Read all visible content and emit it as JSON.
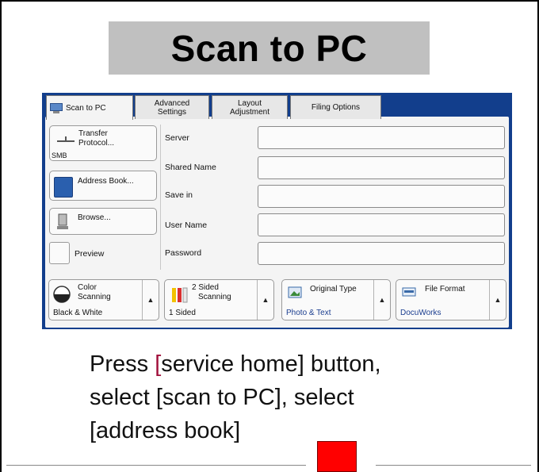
{
  "slide": {
    "title": "Scan to PC",
    "instruction_bracket": "[",
    "instruction_line1_rest": "service home] button,",
    "instruction_line2": "select [scan to PC], select",
    "instruction_line3": "[address book]"
  },
  "tabs": [
    {
      "label": "Scan to PC",
      "active": true,
      "icon": "pc-monitor-icon"
    },
    {
      "label_line1": "Advanced",
      "label_line2": "Settings"
    },
    {
      "label_line1": "Layout",
      "label_line2": "Adjustment"
    },
    {
      "label": "Filing Options"
    }
  ],
  "side_buttons": {
    "transfer_protocol": {
      "label_line1": "Transfer",
      "label_line2": "Protocol...",
      "value": "SMB",
      "icon": "network-icon"
    },
    "address_book": {
      "label": "Address Book...",
      "icon": "address-book-icon"
    },
    "browse": {
      "label": "Browse...",
      "icon": "computer-icon"
    },
    "preview": {
      "label": "Preview"
    }
  },
  "fields": [
    {
      "label": "Server",
      "value": ""
    },
    {
      "label": "Shared Name",
      "value": ""
    },
    {
      "label": "Save in",
      "value": ""
    },
    {
      "label": "User Name",
      "value": ""
    },
    {
      "label": "Password",
      "value": ""
    }
  ],
  "bottom_buttons": [
    {
      "label_line1": "Color",
      "label_line2": "Scanning",
      "value": "Black & White",
      "icon": "color-circle-icon"
    },
    {
      "label_line1": "2 Sided",
      "label_line2": "Scanning",
      "value": "1 Sided",
      "icon": "duplex-pages-icon"
    },
    {
      "label": "Original Type",
      "value": "Photo & Text",
      "icon": "photo-icon"
    },
    {
      "label": "File Format",
      "value": "DocuWorks",
      "icon": "file-format-icon"
    }
  ],
  "colors": {
    "panel_header": "#123e8c",
    "title_bg": "#c0c0c0",
    "marker": "#ff0000",
    "bracket": "#a00f3a",
    "value_blue": "#1a3d8f"
  }
}
